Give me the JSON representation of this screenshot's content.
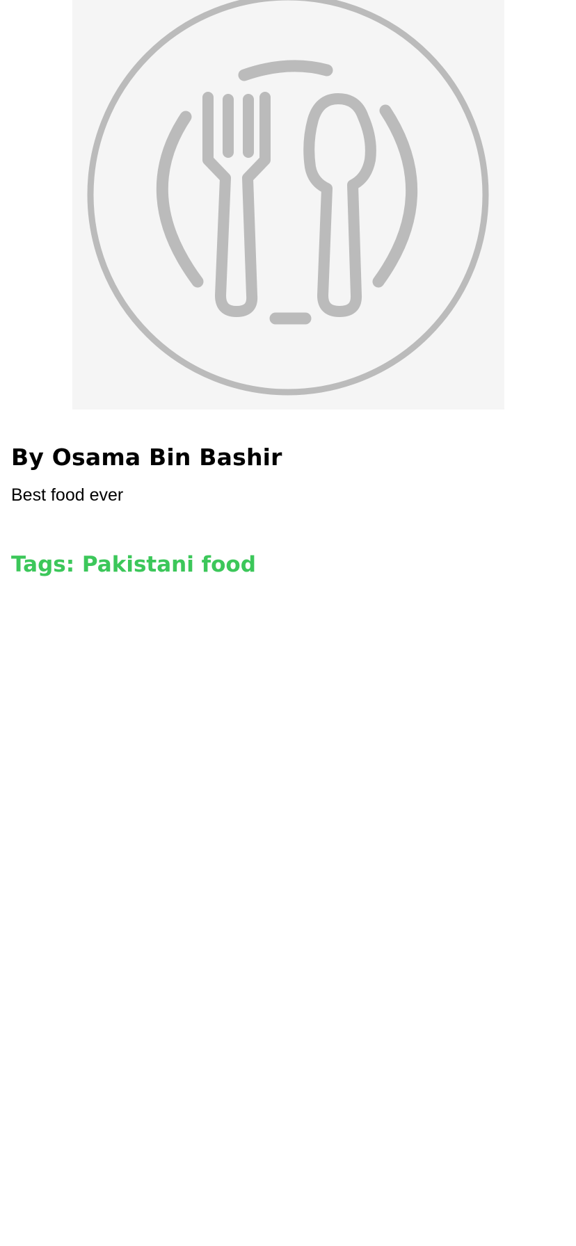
{
  "recipe": {
    "image_icon": "plate-fork-spoon-icon",
    "author": "By Osama Bin Bashir",
    "description": "Best food ever",
    "tags": "Tags: Pakistani food"
  },
  "colors": {
    "placeholder_bg": "#f5f5f5",
    "placeholder_icon": "#bbbbbb",
    "text": "#000000",
    "tag": "#3cc75a"
  }
}
